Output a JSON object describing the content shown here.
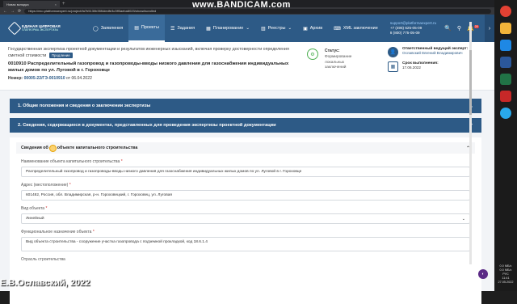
{
  "browser": {
    "tab_title": "Новая вкладка",
    "tab_close": "×",
    "new_tab": "+",
    "url": "https://exo.platformaexpert.ru/project/fa7b5130b35f4dedfe3c3ff3aeba8023/show#scrolled",
    "back": "←",
    "forward": "→",
    "reload": "⟳"
  },
  "watermark": {
    "text": "www.BANDICAM.com"
  },
  "logo": {
    "title": "ЕДИНАЯ ЦИФРОВАЯ",
    "subtitle": "ПЛАТФОРМА ЭКСПЕРТИЗЫ",
    "icon": "platform-logo-icon"
  },
  "menu": [
    {
      "label": "Заявления",
      "icon": "◯"
    },
    {
      "label": "Проекты",
      "icon": "▤"
    },
    {
      "label": "Задания",
      "icon": "☰"
    },
    {
      "label": "Планирование",
      "icon": "▦"
    },
    {
      "label": "Реестры",
      "icon": "▥"
    },
    {
      "label": "Архив",
      "icon": "▣"
    },
    {
      "label": "XML заключение",
      "icon": "⌨"
    }
  ],
  "contacts": {
    "email": "support@platformaexpert.ru",
    "phone1": "+7 (495) 625-05-09",
    "phone2": "8 (800) 775-05-09"
  },
  "header_icons": {
    "search": "🔍",
    "binoculars": "⚲",
    "bell": "🔔",
    "notifications_count": "28"
  },
  "header_arrow": "›",
  "project": {
    "description": "Государственная экспертиза проектной документации и результатов инженерных изысканий, включая проверку достоверности определения сметной стоимости",
    "tag": "Продление",
    "title": "0010910 Распределительный газопровод и газопроводы-вводы низкого давления для газоснабжения индивидуальных жилых домов по ул. Луговой в г. Гороховце",
    "number_label": "Номер:",
    "number": "00005-22/ГЭ-0010910",
    "number_date": "от 06.04.2022"
  },
  "status": {
    "label": "Статус:",
    "value": "Формирование локальных заключений"
  },
  "expert": {
    "label": "Ответственный ведущий эксперт:",
    "name": "Ославский Евгений Владимирович",
    "deadline_label": "Срок выполнения:",
    "deadline": "17.06.2022"
  },
  "sections": [
    {
      "label": "1. Общие положения и сведения о заключении экспертизы"
    },
    {
      "label": "2. Сведения, содержащиеся в документах, представленных для проведения экспертизы проектной документации"
    }
  ],
  "subsection": {
    "label_part1": "Сведения об",
    "label_part2": "объекте капитального строительства"
  },
  "fields": {
    "name_label": "Наименование объекта капитального строительства",
    "name_value": "Распределительный газопровод и газопроводы-вводы низкого давления для газоснабжения индивидуальных жилых домов по ул. Луговой в г. Гороховце",
    "address_label": "Адрес (местоположение)",
    "address_value": "601482, Россия, обл. Владимирская, р-н. Гороховецкий, г. Гороховец, ул. Луговая",
    "type_label": "Вид объекта",
    "type_value": "Линейный",
    "purpose_label": "Функциональное назначение объекта",
    "purpose_value": "Вид объекта строительства - сооружение участка газопровода с подземной прокладкой, код 18.6.1.4",
    "industry_label": "Отрасль строительства",
    "required_mark": "*"
  },
  "chev_up": "⌃",
  "chev_down": "⌄",
  "fab": "◐",
  "taskbar": {
    "time": "11:41",
    "date": "27.05.2022",
    "lang": "РУС",
    "net1": "0.0 МБ/с",
    "net2": "0.0 МБ/с"
  },
  "author": "Е.В.Ославский, 2022",
  "colors": {
    "primary": "#2d5a86",
    "status_green": "#4caf50",
    "required": "#d32f2f"
  }
}
